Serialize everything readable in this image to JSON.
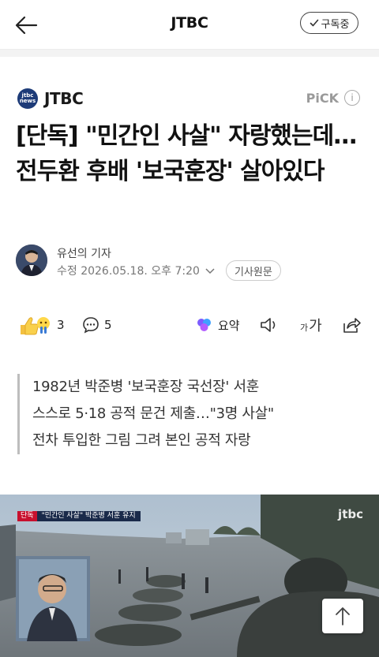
{
  "header": {
    "title": "JTBC",
    "subscribe_label": "구독중"
  },
  "press": {
    "logo_text": "jtbc news",
    "name": "JTBC",
    "pick_label": "PiCK",
    "info_symbol": "i"
  },
  "article": {
    "headline": "[단독] \"민간인 사살\" 자랑했는데…전두환 후배 '보국훈장' 살아있다",
    "reporter": "유선의 기자",
    "timestamp": "수정 2026.05.18. 오후 7:20",
    "original_label": "기사원문"
  },
  "actions": {
    "reaction_count": "3",
    "comment_count": "5",
    "summary_label": "요약",
    "font_label_small": "가",
    "font_label_large": "가"
  },
  "summary_lines": [
    "1982년 박준병 '보국훈장 국선장' 서훈",
    "스스로 5·18 공적 문건 제출…\"3명 사살\"",
    "전차 투입한 그림 그려 본인 공적 자랑"
  ],
  "media": {
    "tag": "단독",
    "caption": "\"민간인 사살\" 박준병 서훈 유지",
    "watermark": "jtbc"
  },
  "colors": {
    "press_logo": "#1d3b78",
    "summary_bar": "#bdbdbd",
    "tag_red": "#c8102e"
  }
}
